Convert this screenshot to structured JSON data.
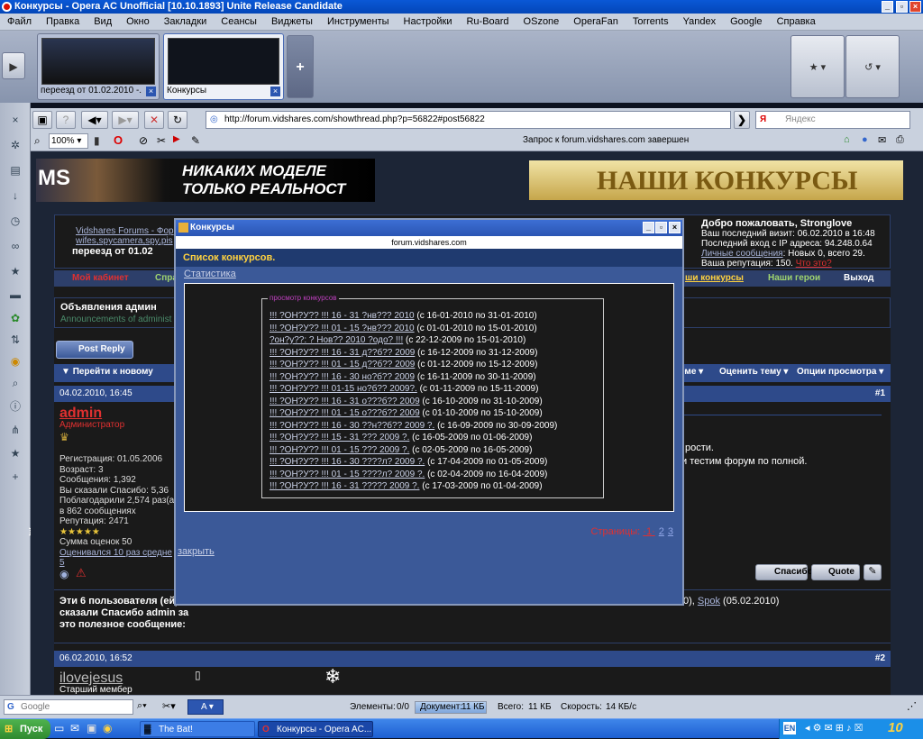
{
  "window": {
    "title": "Конкурсы - Opera AC Unofficial [10.10.1893] Unite Release Candidate"
  },
  "menu": [
    "Файл",
    "Правка",
    "Вид",
    "Окно",
    "Закладки",
    "Сеансы",
    "Виджеты",
    "Инструменты",
    "Настройки",
    "Ru-Board",
    "OSzone",
    "OperaFan",
    "Torrents",
    "Yandex",
    "Google",
    "Справка"
  ],
  "tabs": [
    {
      "label": "переезд от 01.02.2010 -..."
    },
    {
      "label": "Конкурсы"
    }
  ],
  "address": {
    "url": "http://forum.vidshares.com/showthread.php?p=56822#post56822",
    "search_placeholder": "Яндекс",
    "zoom": "100%",
    "status_text": "Запрос к forum.vidshares.com завершен"
  },
  "page": {
    "banner_left": "НИКАКИХ МОДЕЛЕ ТОЛЬКО РЕАЛЬНОСТ",
    "banner_left_logo": "MS",
    "banner_right": "НАШИ КОНКУРСЫ",
    "breadcrumb_forum": "Vidshares Forums - Фор",
    "breadcrumb_sub": "wifes,spycamera,spy,pis",
    "thread_title": "переезд от 01.02",
    "welcome": "Добро пожаловать, Stronglove",
    "last_visit": "Ваш последний визит: 06.02.2010 в 16:48",
    "last_login": "Последний вход с IP адреса: 94.248.0.64",
    "pm_label": "Личные сообщения",
    "pm_text": ": Новых 0, всего 29.",
    "reputation_text": "Ваша репутация: 150.",
    "reputation_link": "Что это?",
    "nav": {
      "my_cabinet": "Мой кабинет",
      "spravka": "Спра",
      "contests": "ши конкурсы",
      "heroes": "Наши герои",
      "exit": "Выход"
    },
    "announce_title": "Объявления админ",
    "announce_sub": "Announcements of administ",
    "post_reply": "Post Reply",
    "goto_new": "Перейти к новому",
    "rate_thread": "Оценить тему",
    "view_options": "Опции просмотра",
    "theme_menu": "еме",
    "post1": {
      "date": "04.02.2010, 16:45",
      "num": "1",
      "author": "admin",
      "role": "Администратор",
      "reg": "Регистрация: 01.05.2006",
      "age": "Возраст: 3",
      "posts": "Сообщения: 1,392",
      "thanked": "Вы сказали Спасибо: 5,36",
      "thanked_by": "Поблагодарили 2,574 раз(а)",
      "in_posts": "в 862 сообщениях",
      "rep": "Репутация: 2471",
      "score": "Сумма оценок 50",
      "rated": "Оценивался 10 раз средне",
      "rated2": "5",
      "text1": "рости.",
      "text2": "и тестим форум по полной."
    },
    "thanks_label": "Спасибо",
    "quote_label": "Quote",
    "thanks_block": "Эти 6 пользователя (ей) сказали Спасибо admin за это полезное сообщение:",
    "thanks_list_end": "0), ",
    "thanks_list_user": "Spok",
    "thanks_list_date": " (05.02.2010)",
    "post2": {
      "date": "06.02.2010, 16:52",
      "num": "2",
      "author": "ilovejesus",
      "role": "Старший мембер"
    }
  },
  "dialog": {
    "title": "Конкурсы",
    "host": "forum.vidshares.com",
    "heading": "Список конкурсов.",
    "tab": "Статистика",
    "legend": "просмотр конкурсов",
    "items": [
      {
        "link": "!!! ?ОН?У?? !!! 16 - 31 ?нв??? 2010",
        "range": "(с 16-01-2010 по 31-01-2010)"
      },
      {
        "link": "!!! ?ОН?У?? !!! 01 - 15 ?нв??? 2010",
        "range": "(с 01-01-2010 по 15-01-2010)"
      },
      {
        "link": "?он?у??: ? Нов?? 2010 ?одо? !!!",
        "range": "(с 22-12-2009 по 15-01-2010)"
      },
      {
        "link": "!!! ?ОН?У?? !!! 16 - 31 д??б?? 2009",
        "range": "(с 16-12-2009 по 31-12-2009)"
      },
      {
        "link": "!!! ?ОН?У?? !!! 01 - 15 д??б?? 2009",
        "range": "(с 01-12-2009 по 15-12-2009)"
      },
      {
        "link": "!!! ?ОН?У?? !!! 16 - 30 но?б?? 2009",
        "range": "(с 16-11-2009 по 30-11-2009)"
      },
      {
        "link": "!!! ?ОН?У?? !!! 01-15 но?б?? 2009?.",
        "range": "(с 01-11-2009 по 15-11-2009)"
      },
      {
        "link": "!!! ?ОН?У?? !!! 16 - 31 о???б?? 2009",
        "range": "(с 16-10-2009 по 31-10-2009)"
      },
      {
        "link": "!!! ?ОН?У?? !!! 01 - 15 о???б?? 2009",
        "range": "(с 01-10-2009 по 15-10-2009)"
      },
      {
        "link": "!!! ?ОН?У?? !!! 16 - 30 ??н??б?? 2009 ?.",
        "range": "(с 16-09-2009 по 30-09-2009)"
      },
      {
        "link": "!!! ?ОН?У?? !!! 15 - 31 ??? 2009 ?.",
        "range": "(с 16-05-2009 по 01-06-2009)"
      },
      {
        "link": "!!! ?ОН?У?? !!! 01 - 15 ??? 2009 ?.",
        "range": "(с 02-05-2009 по 16-05-2009)"
      },
      {
        "link": "!!! ?ОН?У?? !!! 16 - 30 ????л? 2009 ?.",
        "range": "(с 17-04-2009 по 01-05-2009)"
      },
      {
        "link": "!!! ?ОН?У?? !!! 01 - 15 ????л? 2009 ?.",
        "range": "(с 02-04-2009 по 16-04-2009)"
      },
      {
        "link": "!!! ?ОН?У?? !!! 16 - 31 ????? 2009 ?.",
        "range": "(с 17-03-2009 по 01-04-2009)"
      }
    ],
    "pages_label": "Страницы:",
    "pages_current": "1",
    "pages": [
      "2",
      "3"
    ],
    "close": "закрыть"
  },
  "status": {
    "search": "Google",
    "zoom": "A",
    "elements_label": "Элементы:",
    "elements": "0/0",
    "doc_label": "Документ:",
    "doc": "11 КБ",
    "total_label": "Всего:",
    "total": "11 КБ",
    "speed_label": "Скорость:",
    "speed": "14 КБ/с"
  },
  "taskbar": {
    "start": "Пуск",
    "tasks": [
      "The Bat!",
      "Конкурсы - Opera AC..."
    ],
    "time": "10"
  }
}
